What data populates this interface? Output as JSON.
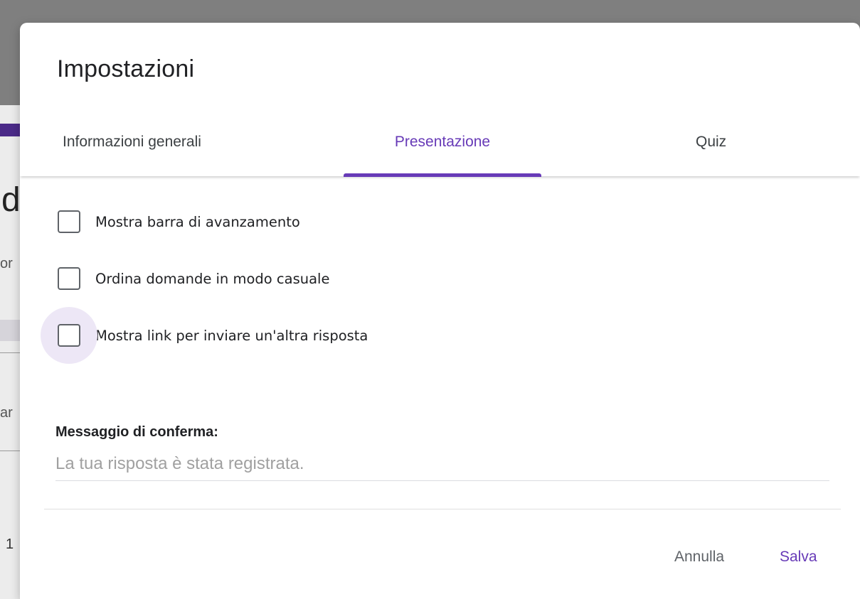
{
  "background": {
    "fragments": [
      "d",
      "or",
      "ar",
      "1"
    ]
  },
  "dialog": {
    "title": "Impostazioni",
    "tabs": [
      {
        "label": "Informazioni generali",
        "active": false
      },
      {
        "label": "Presentazione",
        "active": true
      },
      {
        "label": "Quiz",
        "active": false
      }
    ],
    "options": [
      {
        "label": "Mostra barra di avanzamento",
        "checked": false
      },
      {
        "label": "Ordina domande in modo casuale",
        "checked": false
      },
      {
        "label": "Mostra link per inviare un'altra risposta",
        "checked": false,
        "focused": true
      }
    ],
    "confirmation": {
      "label": "Messaggio di conferma:",
      "value": "",
      "placeholder": "La tua risposta è stata registrata."
    },
    "buttons": {
      "cancel": "Annulla",
      "save": "Salva"
    }
  },
  "colors": {
    "accent": "#673ab7",
    "overlay": "#7f7f7f",
    "ripple": "#ede7f6"
  }
}
